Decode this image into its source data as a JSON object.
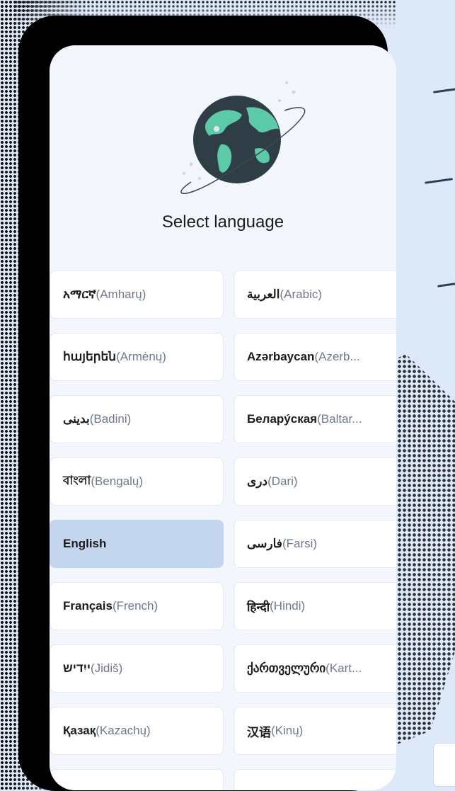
{
  "screen": {
    "title": "Select language"
  },
  "languages": [
    {
      "native": "አማርኛ",
      "translated": "(Amharų)",
      "selected": false
    },
    {
      "native": "العربية",
      "translated": "(Arabic)",
      "selected": false
    },
    {
      "native": "հայերեն",
      "translated": "(Armėnų)",
      "selected": false
    },
    {
      "native": "Azərbaycan",
      "translated": "(Azerb...",
      "selected": false
    },
    {
      "native": "بدینی",
      "translated": "(Badini)",
      "selected": false
    },
    {
      "native": "Беларýская",
      "translated": "(Baltar...",
      "selected": false
    },
    {
      "native": "বাংলা",
      "translated": "(Bengalų)",
      "selected": false
    },
    {
      "native": "دری",
      "translated": "(Dari)",
      "selected": false
    },
    {
      "native": "English",
      "translated": "",
      "selected": true
    },
    {
      "native": "فارسی",
      "translated": "(Farsi)",
      "selected": false
    },
    {
      "native": "Français",
      "translated": "(French)",
      "selected": false
    },
    {
      "native": "हिन्दी",
      "translated": "(Hindi)",
      "selected": false
    },
    {
      "native": "ייִדיש",
      "translated": "(Jidiš)",
      "selected": false
    },
    {
      "native": "ქართველური",
      "translated": "(Kart...",
      "selected": false
    },
    {
      "native": "Қазақ",
      "translated": "(Kazachų)",
      "selected": false
    },
    {
      "native": "汉语",
      "translated": "(Kinų)",
      "selected": false
    },
    {
      "native": "",
      "translated": "",
      "selected": false
    },
    {
      "native": "",
      "translated": "",
      "selected": false
    }
  ],
  "colors": {
    "background": "#dde9f8",
    "screen": "#f3f6fc",
    "selected": "#c3d6ee",
    "globe": "#2f3e46",
    "land": "#5cc9a7"
  }
}
